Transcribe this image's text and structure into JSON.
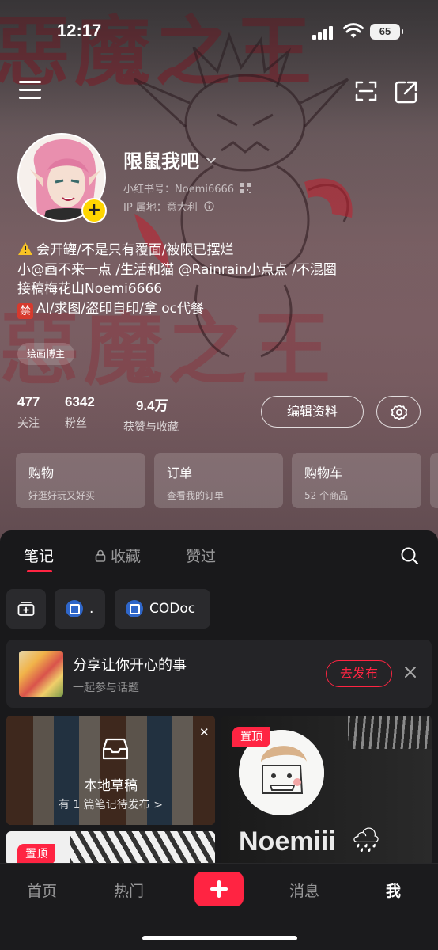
{
  "status_bar": {
    "time": "12:17",
    "battery": "65"
  },
  "profile": {
    "name": "限鼠我吧",
    "redbook_id": "小红书号：Noemi6666",
    "ip_location": "IP 属地：意大利",
    "bio": [
      "会开罐/不是只有覆面/被限已摆烂",
      "小@画不来一点 /生活和猫 @Rainrain小点点  /不混圈",
      "接稿梅花山Noemi6666",
      "AI/求图/盗印自印/拿 oc代餐"
    ],
    "bio_ban_glyph": "禁",
    "tag": "绘画博主"
  },
  "stats": [
    {
      "value": "477",
      "label": "关注"
    },
    {
      "value": "6342",
      "label": "粉丝"
    },
    {
      "value": "9.4万",
      "label": "获赞与收藏"
    }
  ],
  "actions": {
    "edit_profile": "编辑资料"
  },
  "shortcuts": [
    {
      "title": "购物",
      "subtitle": "好逛好玩又好买"
    },
    {
      "title": "订单",
      "subtitle": "查看我的订单"
    },
    {
      "title": "购物车",
      "subtitle": "52 个商品"
    }
  ],
  "tabs": {
    "notes": "笔记",
    "collections": "收藏",
    "likes": "赞过"
  },
  "chips": [
    {
      "label": "."
    },
    {
      "label": "CODoc"
    }
  ],
  "topic": {
    "title": "分享让你开心的事",
    "subtitle": "一起参与话题",
    "button": "去发布"
  },
  "draft": {
    "title": "本地草稿",
    "subtitle": "有 1 篇笔记待发布 >"
  },
  "pinned_badge": "置顶",
  "pinned_card_text": "Noemiii",
  "bottom_nav": {
    "home": "首页",
    "hot": "热门",
    "messages": "消息",
    "me": "我"
  },
  "colors": {
    "accent": "#ff2442",
    "avatar_badge": "#ffd600"
  }
}
